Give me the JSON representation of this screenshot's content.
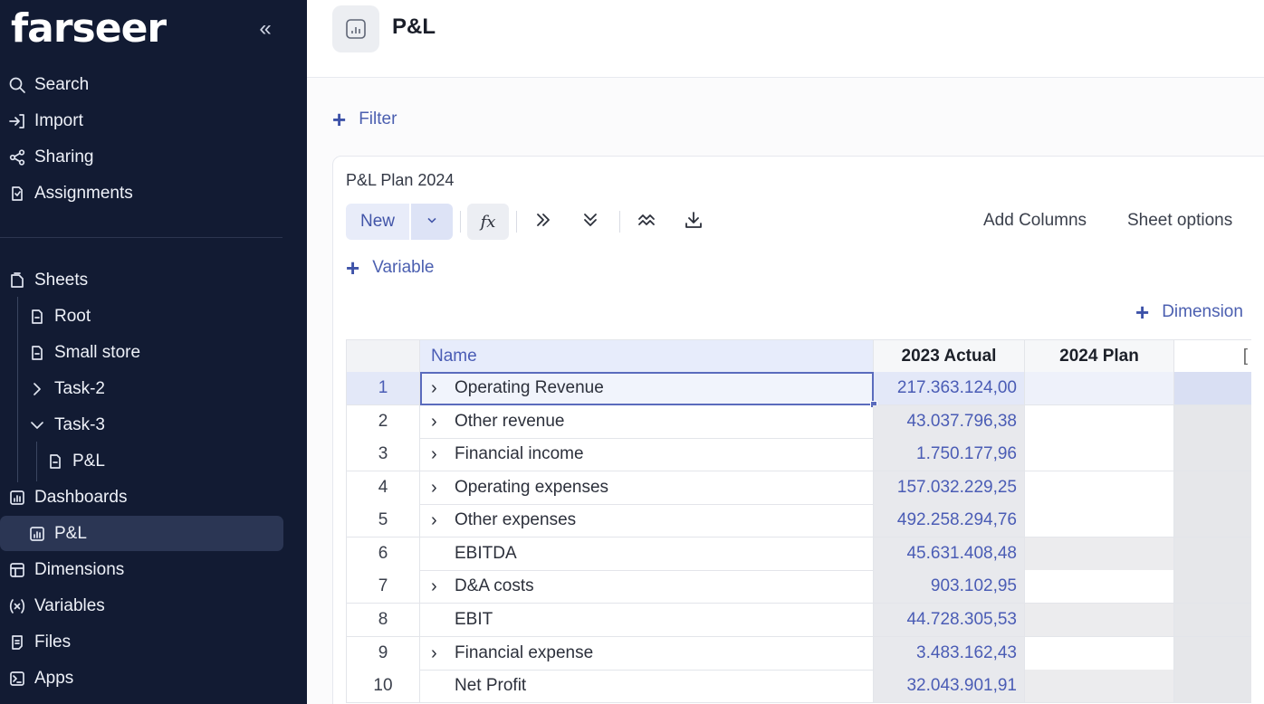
{
  "sidebar": {
    "logo": "farseer",
    "collapse_glyph": "«",
    "top_items": [
      {
        "label": "Search",
        "icon": "search-icon"
      },
      {
        "label": "Import",
        "icon": "import-icon"
      },
      {
        "label": "Sharing",
        "icon": "share-icon"
      },
      {
        "label": "Assignments",
        "icon": "assignment-icon"
      }
    ],
    "sheets": {
      "label": "Sheets",
      "children": [
        {
          "label": "Root",
          "icon": "sheet-icon"
        },
        {
          "label": "Small store",
          "icon": "sheet-icon"
        },
        {
          "label": "Task-2",
          "icon": "chevron-right-icon"
        },
        {
          "label": "Task-3",
          "icon": "chevron-down-icon",
          "children": [
            {
              "label": "P&L",
              "icon": "sheet-icon"
            }
          ]
        }
      ]
    },
    "dashboards": {
      "label": "Dashboards",
      "children": [
        {
          "label": "P&L",
          "active": true
        }
      ]
    },
    "bottom_items": [
      {
        "label": "Dimensions",
        "icon": "dimensions-icon"
      },
      {
        "label": "Variables",
        "icon": "variables-icon"
      },
      {
        "label": "Files",
        "icon": "files-icon"
      },
      {
        "label": "Apps",
        "icon": "apps-icon"
      }
    ]
  },
  "header": {
    "title": "P&L",
    "icon": "dashboard-icon"
  },
  "filter": {
    "label": "Filter"
  },
  "sheet": {
    "title": "P&L Plan 2024",
    "toolbar": {
      "new_label": "New",
      "fx_label": "fx",
      "add_columns_label": "Add Columns",
      "sheet_options_label": "Sheet options"
    },
    "variable_label": "Variable",
    "dimension_label": "Dimension",
    "columns": [
      "Name",
      "2023 Actual",
      "2024 Plan",
      "["
    ],
    "rows": [
      {
        "num": "1",
        "name": "Operating Revenue",
        "expandable": true,
        "actual": "217.363.124,00"
      },
      {
        "num": "2",
        "name": "Other revenue",
        "expandable": true,
        "actual": "43.037.796,38"
      },
      {
        "num": "3",
        "name": "Financial income",
        "expandable": true,
        "actual": "1.750.177,96"
      },
      {
        "num": "4",
        "name": "Operating expenses",
        "expandable": true,
        "actual": "157.032.229,25"
      },
      {
        "num": "5",
        "name": "Other expenses",
        "expandable": true,
        "actual": "492.258.294,76"
      },
      {
        "num": "6",
        "name": "EBITDA",
        "expandable": false,
        "actual": "45.631.408,48"
      },
      {
        "num": "7",
        "name": "D&A costs",
        "expandable": true,
        "actual": "903.102,95"
      },
      {
        "num": "8",
        "name": "EBIT",
        "expandable": false,
        "actual": "44.728.305,53"
      },
      {
        "num": "9",
        "name": "Financial expense",
        "expandable": true,
        "actual": "3.483.162,43"
      },
      {
        "num": "10",
        "name": "Net Profit",
        "expandable": false,
        "actual": "32.043.901,91"
      }
    ]
  },
  "colors": {
    "sidebar_bg": "#121b33",
    "sidebar_active": "#2b3654",
    "accent": "#4a5cb5",
    "actual_cell_bg": "#e8e9ed"
  }
}
